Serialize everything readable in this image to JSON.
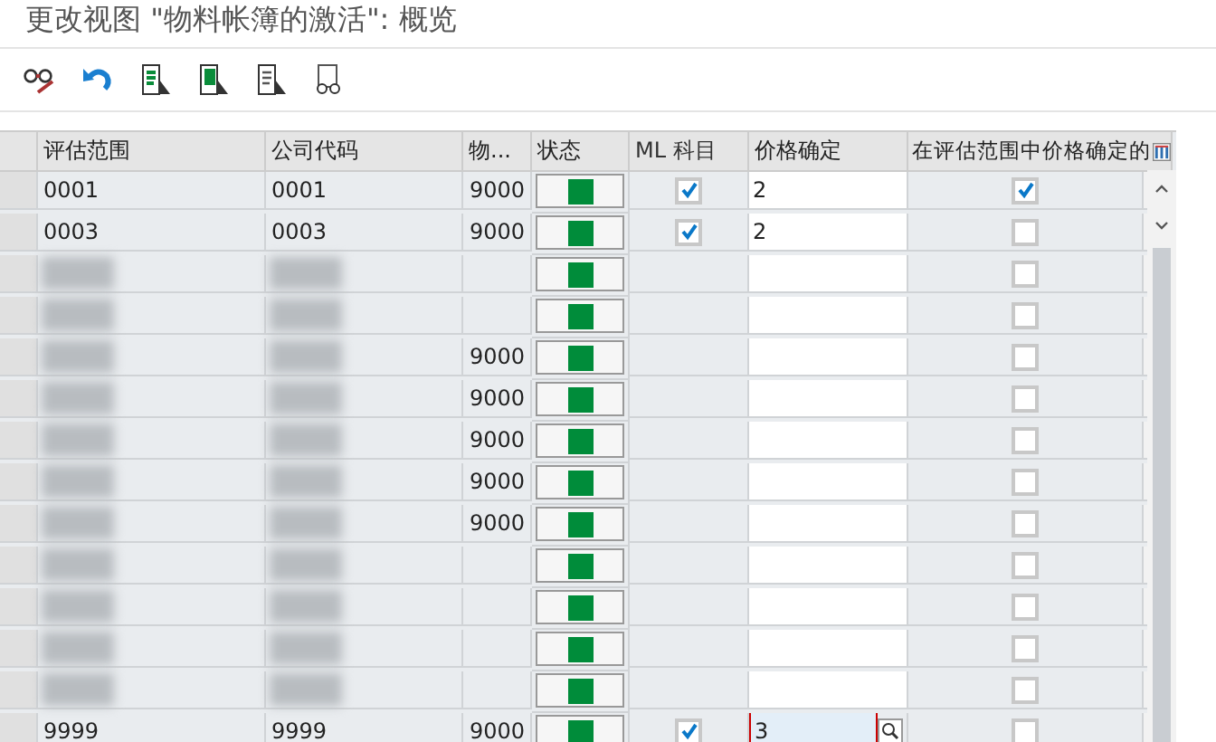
{
  "window": {
    "title": "更改视图 \"物料帐簿的激活\": 概览"
  },
  "table": {
    "columns": [
      "评估范围",
      "公司代码",
      "物...",
      "状态",
      "ML 科目",
      "价格确定",
      "在评估范围中价格确定的"
    ],
    "rows": [
      {
        "valuation_area": "0001",
        "company_code": "0001",
        "column_3": "9000",
        "status_ok": true,
        "ml_account": true,
        "price": "2",
        "price_in_area": true,
        "blurred": false,
        "focused": false
      },
      {
        "valuation_area": "0003",
        "company_code": "0003",
        "column_3": "9000",
        "status_ok": true,
        "ml_account": true,
        "price": "2",
        "price_in_area": false,
        "blurred": false,
        "focused": false
      },
      {
        "status_ok": true,
        "price_in_area": false,
        "blurred": true,
        "focused": false
      },
      {
        "status_ok": true,
        "price_in_area": false,
        "blurred": true,
        "focused": false
      },
      {
        "column_3": "9000",
        "status_ok": true,
        "price_in_area": false,
        "blurred": true,
        "focused": false
      },
      {
        "column_3": "9000",
        "status_ok": true,
        "price_in_area": false,
        "blurred": true,
        "focused": false
      },
      {
        "column_3": "9000",
        "status_ok": true,
        "price_in_area": false,
        "blurred": true,
        "focused": false
      },
      {
        "column_3": "9000",
        "status_ok": true,
        "price_in_area": false,
        "blurred": true,
        "focused": false
      },
      {
        "column_3": "9000",
        "status_ok": true,
        "price_in_area": false,
        "blurred": true,
        "focused": false
      },
      {
        "status_ok": true,
        "price_in_area": false,
        "blurred": true,
        "focused": false
      },
      {
        "status_ok": true,
        "price_in_area": false,
        "blurred": true,
        "focused": false
      },
      {
        "status_ok": true,
        "price_in_area": false,
        "blurred": true,
        "focused": false
      },
      {
        "status_ok": true,
        "price_in_area": false,
        "blurred": true,
        "focused": false
      },
      {
        "valuation_area": "9999",
        "company_code": "9999",
        "column_3": "9000",
        "status_ok": true,
        "ml_account": true,
        "price": "3",
        "price_in_area": false,
        "blurred": false,
        "focused": true
      }
    ]
  }
}
